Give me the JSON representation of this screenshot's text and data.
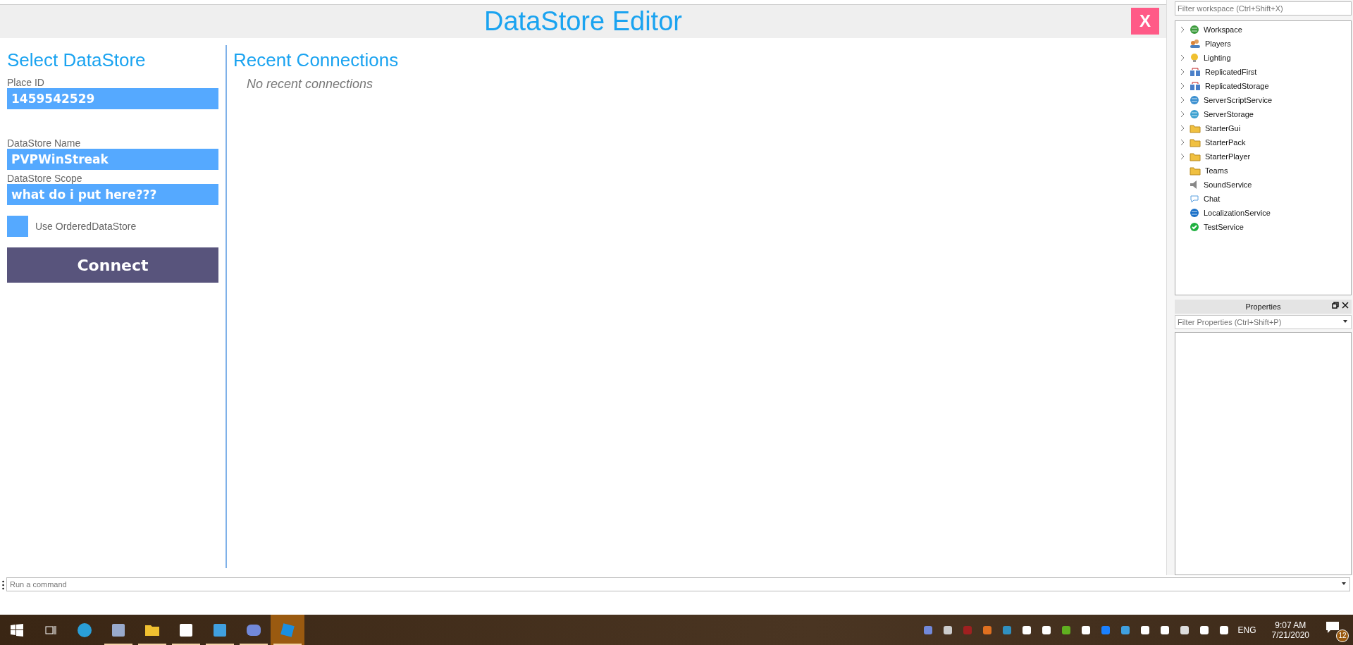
{
  "editor": {
    "title": "DataStore Editor",
    "close": "X"
  },
  "select": {
    "heading": "Select DataStore",
    "fields": [
      {
        "label": "Place ID",
        "value": "1459542529"
      },
      {
        "label": "DataStore Name",
        "value": "PVPWinStreak"
      },
      {
        "label": "DataStore Scope",
        "value": "what do i put here???"
      }
    ],
    "ordered": {
      "label": "Use OrderedDataStore",
      "checked": false
    },
    "connect": "Connect"
  },
  "recent": {
    "heading": "Recent Connections",
    "empty": "No recent connections"
  },
  "explorer": {
    "filter_placeholder": "Filter workspace (Ctrl+Shift+X)",
    "items": [
      {
        "label": "Workspace",
        "expandable": true
      },
      {
        "label": "Players",
        "expandable": false
      },
      {
        "label": "Lighting",
        "expandable": true
      },
      {
        "label": "ReplicatedFirst",
        "expandable": true
      },
      {
        "label": "ReplicatedStorage",
        "expandable": true
      },
      {
        "label": "ServerScriptService",
        "expandable": true
      },
      {
        "label": "ServerStorage",
        "expandable": true
      },
      {
        "label": "StarterGui",
        "expandable": true
      },
      {
        "label": "StarterPack",
        "expandable": true
      },
      {
        "label": "StarterPlayer",
        "expandable": true
      },
      {
        "label": "Teams",
        "expandable": false
      },
      {
        "label": "SoundService",
        "expandable": false
      },
      {
        "label": "Chat",
        "expandable": false
      },
      {
        "label": "LocalizationService",
        "expandable": false
      },
      {
        "label": "TestService",
        "expandable": false
      }
    ]
  },
  "properties": {
    "title": "Properties",
    "filter_placeholder": "Filter Properties (Ctrl+Shift+P)"
  },
  "command_bar": {
    "placeholder": "Run a command"
  },
  "taskbar": {
    "apps": [
      {
        "running": false,
        "selected": false
      },
      {
        "running": true,
        "selected": false
      },
      {
        "running": true,
        "selected": false
      },
      {
        "running": true,
        "selected": false
      },
      {
        "running": true,
        "selected": false
      },
      {
        "running": true,
        "selected": false
      },
      {
        "running": true,
        "selected": true
      }
    ],
    "language": "ENG",
    "time": "9:07 AM",
    "date": "7/21/2020",
    "notifications": "12"
  }
}
